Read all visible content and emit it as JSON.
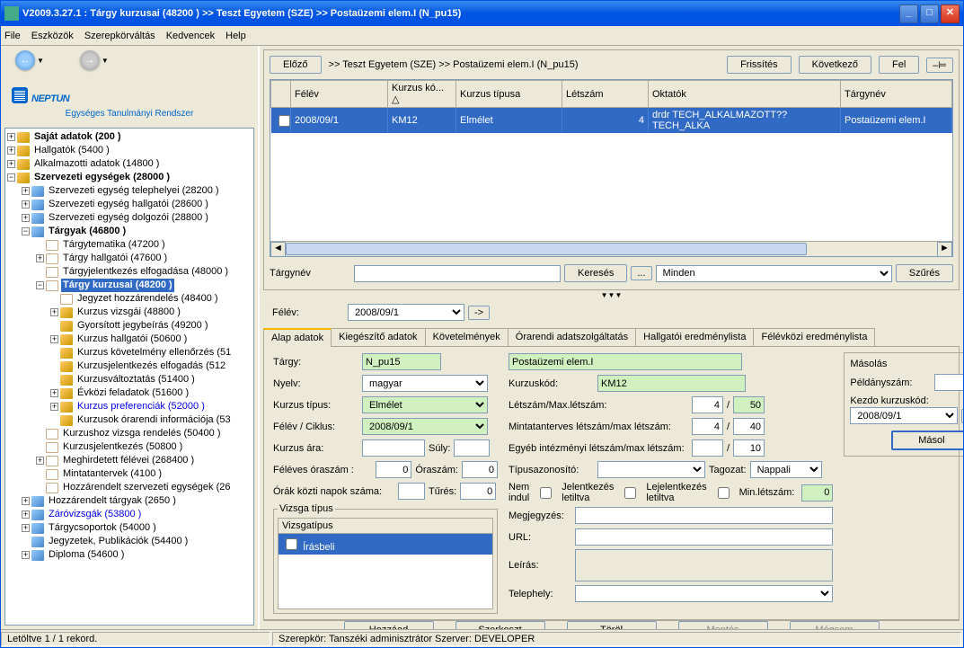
{
  "window": {
    "title": "V2009.3.27.1 : Tárgy kurzusai (48200 )  >> Teszt Egyetem (SZE) >> Postaüzemi elem.I (N_pu15)"
  },
  "menu": {
    "file": "File",
    "tools": "Eszközök",
    "roleswitch": "Szerepkörváltás",
    "fav": "Kedvencek",
    "help": "Help"
  },
  "logo": {
    "text": "NEPTUN",
    "sub": "Egységes Tanulmányi Rendszer"
  },
  "tree": {
    "n0": "Saját adatok (200  )",
    "n1": "Hallgatók (5400  )",
    "n2": "Alkalmazotti adatok (14800  )",
    "n3": "Szervezeti egységek (28000  )",
    "n30": "Szervezeti egység telephelyei (28200  )",
    "n31": "Szervezeti egység hallgatói (28600  )",
    "n32": "Szervezeti egység dolgozói (28800  )",
    "n33": "Tárgyak (46800  )",
    "n330": "Tárgytematika (47200  )",
    "n331": "Tárgy hallgatói (47600  )",
    "n332": "Tárgyjelentkezés elfogadása (48000  )",
    "n333": "Tárgy kurzusai (48200  )",
    "n3330": "Jegyzet hozzárendelés (48400  )",
    "n3331": "Kurzus vizsgái (48800  )",
    "n3332": "Gyorsított jegybeírás (49200  )",
    "n3333": "Kurzus hallgatói (50600  )",
    "n3334": "Kurzus követelmény ellenőrzés (51",
    "n3335": "Kurzusjelentkezés elfogadás (512",
    "n3336": "Kurzusváltoztatás (51400  )",
    "n3337": "Évközi feladatok (51600  )",
    "n3338": "Kurzus preferenciák (52000  )",
    "n3339": "Kurzusok órarendi információja (53",
    "n334": "Kurzushoz vizsga rendelés (50400  )",
    "n335": "Kurzusjelentkezés (50800  )",
    "n336": "Meghirdetett félévei (268400  )",
    "n337": "Mintatantervek (4100  )",
    "n338": "Hozzárendelt szervezeti egységek (26",
    "n34": "Hozzárendelt tárgyak (2650  )",
    "n35": "Záróvizsgák (53800  )",
    "n36": "Tárgycsoportok (54000  )",
    "n37": "Jegyzetek, Publikációk (54400  )",
    "n38": "Diploma (54600  )"
  },
  "topbar": {
    "prev": "Előző",
    "breadcrumb": ">> Teszt Egyetem (SZE) >> Postaüzemi elem.I (N_pu15)",
    "refresh": "Frissítés",
    "next": "Következő",
    "up": "Fel"
  },
  "gridh": {
    "c0": "",
    "c1": "Félév",
    "c2": "Kurzus kó...",
    "c3": "Kurzus típusa",
    "c4": "Létszám",
    "c5": "Oktatók",
    "c6": "Tárgynév"
  },
  "gridr": {
    "c1": "2008/09/1",
    "c2": "KM12",
    "c3": "Elmélet",
    "c4": "4",
    "c5": "drdr TECH_ALKALMAZOTT?? TECH_ALKA",
    "c6": "Postaüzemi elem.I"
  },
  "search": {
    "lbl": "Tárgynév",
    "btn": "Keresés",
    "all": "Minden",
    "filter": "Szűrés"
  },
  "felev": {
    "lbl": "Félév:",
    "val": "2008/09/1"
  },
  "tabs": {
    "t0": "Alap adatok",
    "t1": "Kiegészítő adatok",
    "t2": "Követelmények",
    "t3": "Órarendi adatszolgáltatás",
    "t4": "Hallgatói eredménylista",
    "t5": "Félévközi eredménylista"
  },
  "form": {
    "targy_l": "Tárgy:",
    "targy_code": "N_pu15",
    "targy_name": "Postaüzemi elem.I",
    "nyelv_l": "Nyelv:",
    "nyelv_v": "magyar",
    "kurzuskod_l": "Kurzuskód:",
    "kurzuskod_v": "KM12",
    "ktipus_l": "Kurzus típus:",
    "ktipus_v": "Elmélet",
    "letszam_l": "Létszám/Max.létszám:",
    "letszam_a": "4",
    "letszam_b": "50",
    "fc_l": "Félév / Ciklus:",
    "fc_v": "2008/09/1",
    "minta_l": "Mintatanterves létszám/max létszám:",
    "minta_a": "4",
    "minta_b": "40",
    "kara_l": "Kurzus ára:",
    "suly_l": "Súly:",
    "egyeb_l": "Egyéb intézményi létszám/max létszám:",
    "egyeb_b": "10",
    "feleves_l": "Féléves óraszám :",
    "feleves_v": "0",
    "oraszam_l": "Óraszám:",
    "oraszam_v": "0",
    "tipaz_l": "Típusazonosító:",
    "tagozat_l": "Tagozat:",
    "tagozat_v": "Nappali",
    "orak_l": "Órák közti napok száma:",
    "tures_l": "Tűrés:",
    "tures_v": "0",
    "nemindul_l": "Nem indul",
    "jelet_l": "Jelentkezés letiltva",
    "lejel_l": "Lejelentkezés letiltva",
    "minlet_l": "Min.létszám:",
    "minlet_v": "0",
    "vizsga_l": "Vizsga típus",
    "vizsga_h": "Vizsgatípus",
    "vizsga_r": "Írásbeli",
    "megj_l": "Megjegyzés:",
    "url_l": "URL:",
    "leiras_l": "Leírás:",
    "telep_l": "Telephely:"
  },
  "copy": {
    "title": "Másolás",
    "peld_l": "Példányszám:",
    "kezdo_l": "Kezdo kurzuskód:",
    "kezdo_v": "2008/09/1",
    "btn": "Másol"
  },
  "bottom": {
    "add": "Hozzáad",
    "edit": "Szerkeszt",
    "del": "Töröl",
    "save": "Mentés",
    "cancel": "Mégsem"
  },
  "status": {
    "left": "Letöltve 1 / 1 rekord.",
    "right": "Szerepkör: Tanszéki adminisztrátor   Szerver: DEVELOPER"
  }
}
